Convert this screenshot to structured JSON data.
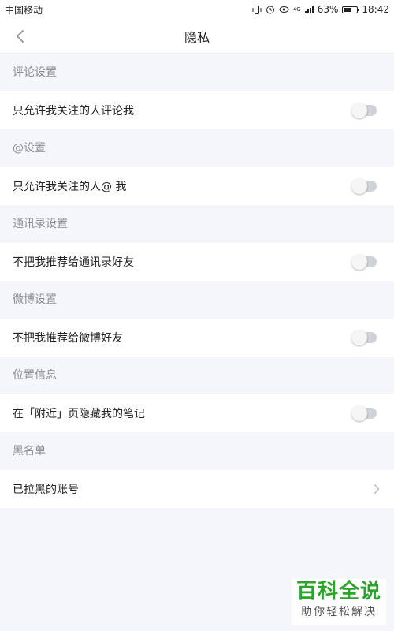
{
  "status_bar": {
    "carrier": "中国移动",
    "battery": "63%",
    "battery_level": 0.63,
    "network": "4G",
    "time": "18:42"
  },
  "nav": {
    "title": "隐私",
    "back_icon": "chevron-left-icon"
  },
  "sections": [
    {
      "header": "评论设置",
      "item": "只允许我关注的人评论我",
      "control": "toggle",
      "on": false
    },
    {
      "header": "@设置",
      "item": "只允许我关注的人@ 我",
      "control": "toggle",
      "on": false
    },
    {
      "header": "通讯录设置",
      "item": "不把我推荐给通讯录好友",
      "control": "toggle",
      "on": false
    },
    {
      "header": "微博设置",
      "item": "不把我推荐给微博好友",
      "control": "toggle",
      "on": false
    },
    {
      "header": "位置信息",
      "item": "在「附近」页隐藏我的笔记",
      "control": "toggle",
      "on": false
    },
    {
      "header": "黑名单",
      "item": "已拉黑的账号",
      "control": "chevron",
      "on": false
    }
  ],
  "watermark": {
    "main": "百科全说",
    "sub": "助你轻松解决"
  },
  "colors": {
    "page_bg": "#f4f6f9",
    "toggle_off": "#cfd2d6",
    "watermark_green": "#2aa52a"
  }
}
